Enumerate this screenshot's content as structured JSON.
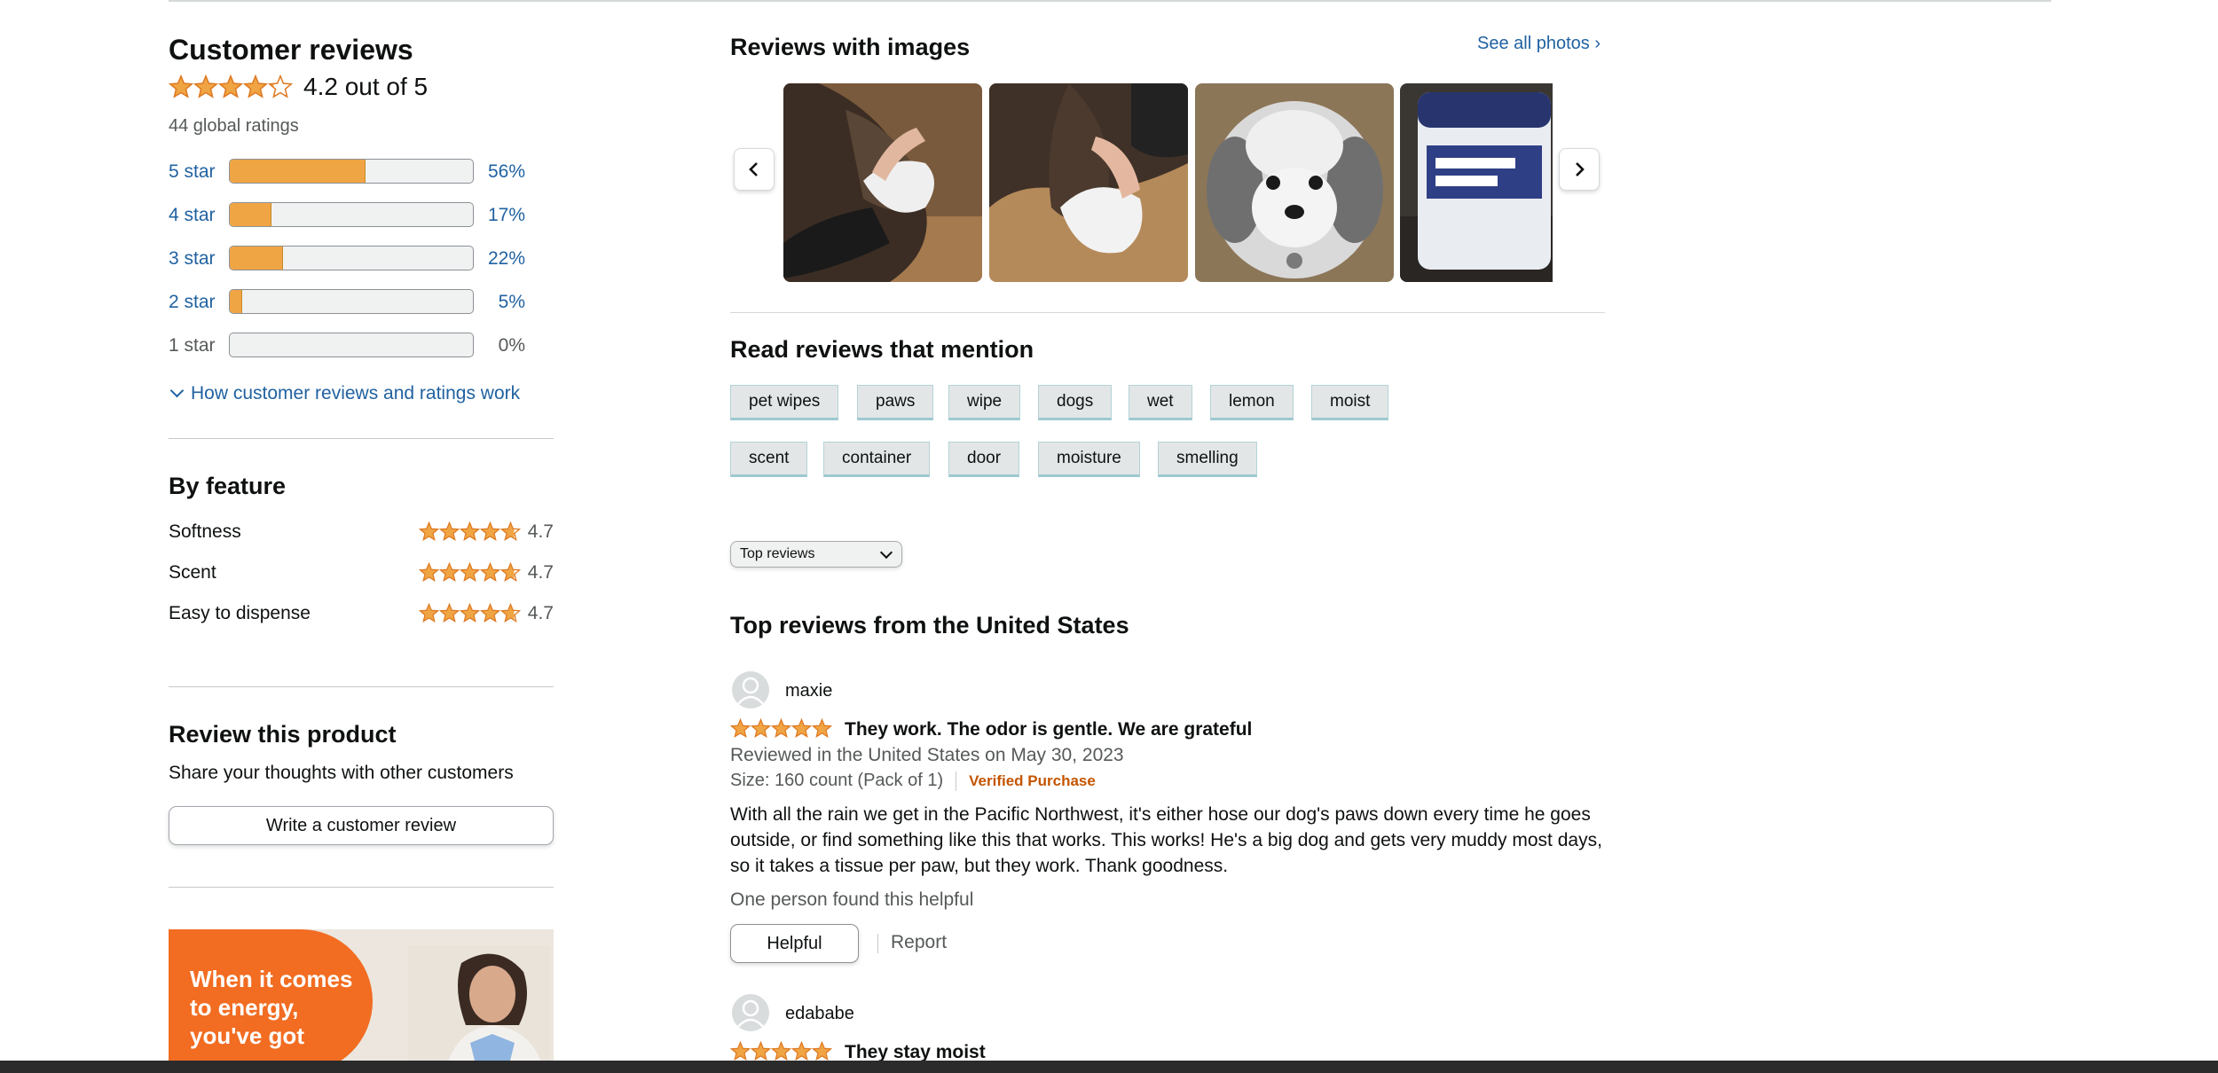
{
  "summary": {
    "title": "Customer reviews",
    "rating": 4.2,
    "rating_text": "4.2 out of 5",
    "global_ratings": "44 global ratings",
    "histogram": [
      {
        "label": "5 star",
        "percent_text": "56%",
        "percent": 56
      },
      {
        "label": "4 star",
        "percent_text": "17%",
        "percent": 17
      },
      {
        "label": "3 star",
        "percent_text": "22%",
        "percent": 22
      },
      {
        "label": "2 star",
        "percent_text": "5%",
        "percent": 5
      },
      {
        "label": "1 star",
        "percent_text": "0%",
        "percent": 0
      }
    ],
    "how_link": "How customer reviews and ratings work"
  },
  "by_feature": {
    "title": "By feature",
    "items": [
      {
        "label": "Softness",
        "value": "4.7"
      },
      {
        "label": "Scent",
        "value": "4.7"
      },
      {
        "label": "Easy to dispense",
        "value": "4.7"
      }
    ]
  },
  "review_product": {
    "title": "Review this product",
    "subtitle": "Share your thoughts with other customers",
    "button": "Write a customer review"
  },
  "ad": {
    "text": "When it comes to energy, you've got"
  },
  "images_section": {
    "title": "Reviews with images",
    "see_all": "See all photos",
    "see_all_glyph": "›",
    "thumbnails": [
      "hand wiping dog with wipe",
      "hand wiping dog paw",
      "white fluffy dog",
      "pet wipes container"
    ]
  },
  "mentions": {
    "title": "Read reviews that mention",
    "chips": [
      "pet wipes",
      "paws",
      "wipe",
      "dogs",
      "wet",
      "lemon",
      "moist",
      "scent",
      "container",
      "door",
      "moisture",
      "smelling"
    ]
  },
  "sort": {
    "selected": "Top reviews"
  },
  "reviews_section": {
    "title": "Top reviews from the United States",
    "reviews": [
      {
        "user": "maxie",
        "rating": 5,
        "title": "They work. The odor is gentle. We are grateful",
        "meta": "Reviewed in the United States on May 30, 2023",
        "size": "Size: 160 count (Pack of 1)",
        "verified": "Verified Purchase",
        "body": "With all the rain we get in the Pacific Northwest, it's either hose our dog's paws down every time he goes outside, or find something like this that works. This works! He's a big dog and gets very muddy most days, so it takes a tissue per paw, but they work. Thank goodness.",
        "helpful_count": "One person found this helpful",
        "helpful_button": "Helpful",
        "report": "Report"
      },
      {
        "user": "edababe",
        "rating": 5,
        "title": "They stay moist"
      }
    ]
  },
  "colors": {
    "star": "#f0a544",
    "link": "#2162a1",
    "verified": "#c45500",
    "ad_orange": "#f26c21"
  },
  "icons": [
    "star-icon",
    "chevron-down-icon",
    "chevron-left-icon",
    "chevron-right-icon",
    "user-avatar-icon"
  ]
}
